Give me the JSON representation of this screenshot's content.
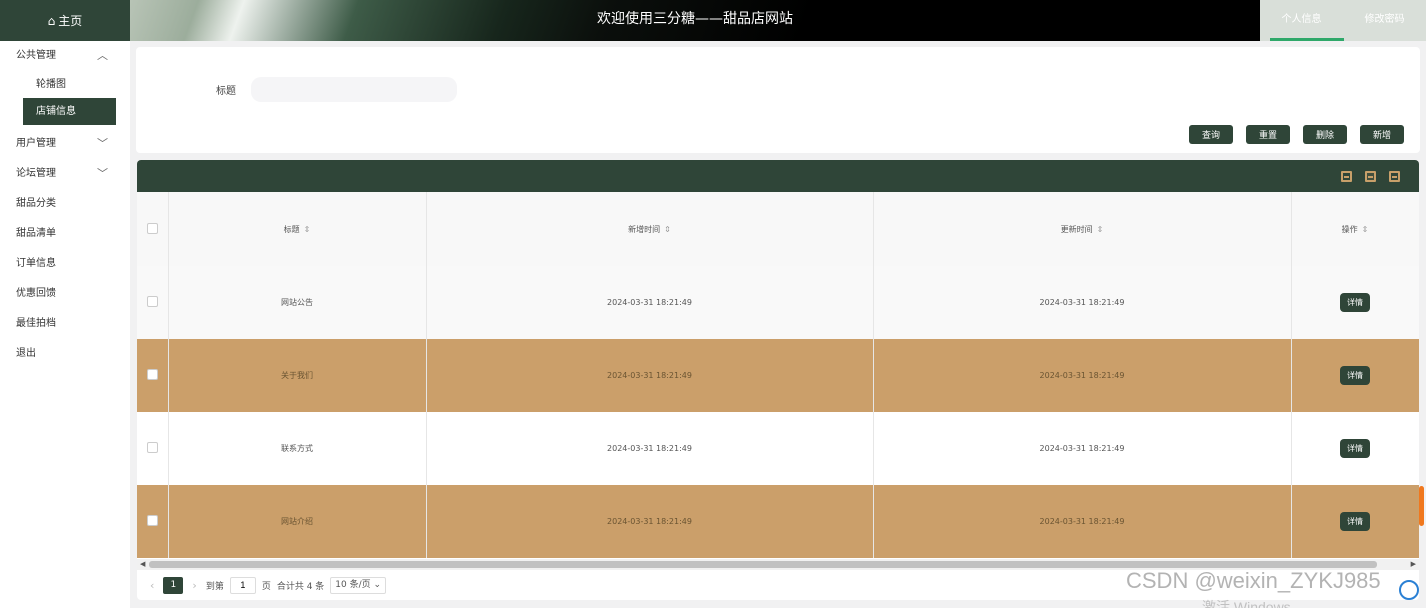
{
  "header": {
    "home_label": "主页",
    "home_icon": "home-icon",
    "title": "欢迎使用三分糖——甜品店网站",
    "user_links": [
      {
        "label": "个人信息",
        "active": true
      },
      {
        "label": "修改密码",
        "active": false
      }
    ]
  },
  "sidebar": {
    "group_public": {
      "label": "公共管理",
      "expanded": true,
      "children": [
        {
          "label": "轮播图",
          "active": false
        },
        {
          "label": "店铺信息",
          "active": true
        }
      ]
    },
    "items": [
      {
        "label": "用户管理",
        "has_children": true
      },
      {
        "label": "论坛管理",
        "has_children": true
      },
      {
        "label": "甜品分类",
        "has_children": false
      },
      {
        "label": "甜品清单",
        "has_children": false
      },
      {
        "label": "订单信息",
        "has_children": false
      },
      {
        "label": "优惠回馈",
        "has_children": false
      },
      {
        "label": "最佳拍档",
        "has_children": false
      },
      {
        "label": "退出",
        "has_children": false
      }
    ]
  },
  "search": {
    "title_label": "标题",
    "title_value": "",
    "buttons": {
      "query": "查询",
      "reset": "重置",
      "delete": "删除",
      "add": "新增"
    }
  },
  "table": {
    "columns": [
      "标题",
      "新增时间",
      "更新时间",
      "操作"
    ],
    "rows": [
      {
        "title": "网站公告",
        "created": "2024-03-31 18:21:49",
        "updated": "2024-03-31 18:21:49",
        "action": "详情"
      },
      {
        "title": "关于我们",
        "created": "2024-03-31 18:21:49",
        "updated": "2024-03-31 18:21:49",
        "action": "详情"
      },
      {
        "title": "联系方式",
        "created": "2024-03-31 18:21:49",
        "updated": "2024-03-31 18:21:49",
        "action": "详情"
      },
      {
        "title": "网站介绍",
        "created": "2024-03-31 18:21:49",
        "updated": "2024-03-31 18:21:49",
        "action": "详情"
      }
    ]
  },
  "pager": {
    "current_page": "1",
    "goto_label": "到第",
    "goto_value": "1",
    "page_unit": "页",
    "total_text": "合计共 4 条",
    "page_size": "10 条/页"
  },
  "colors": {
    "primary": "#2f4538",
    "row_highlight": "#cb9f6a",
    "accent_line": "#2fa86a"
  },
  "watermark": {
    "csdn": "CSDN @weixin_ZYKJ985",
    "activate": "激活 Windows"
  }
}
